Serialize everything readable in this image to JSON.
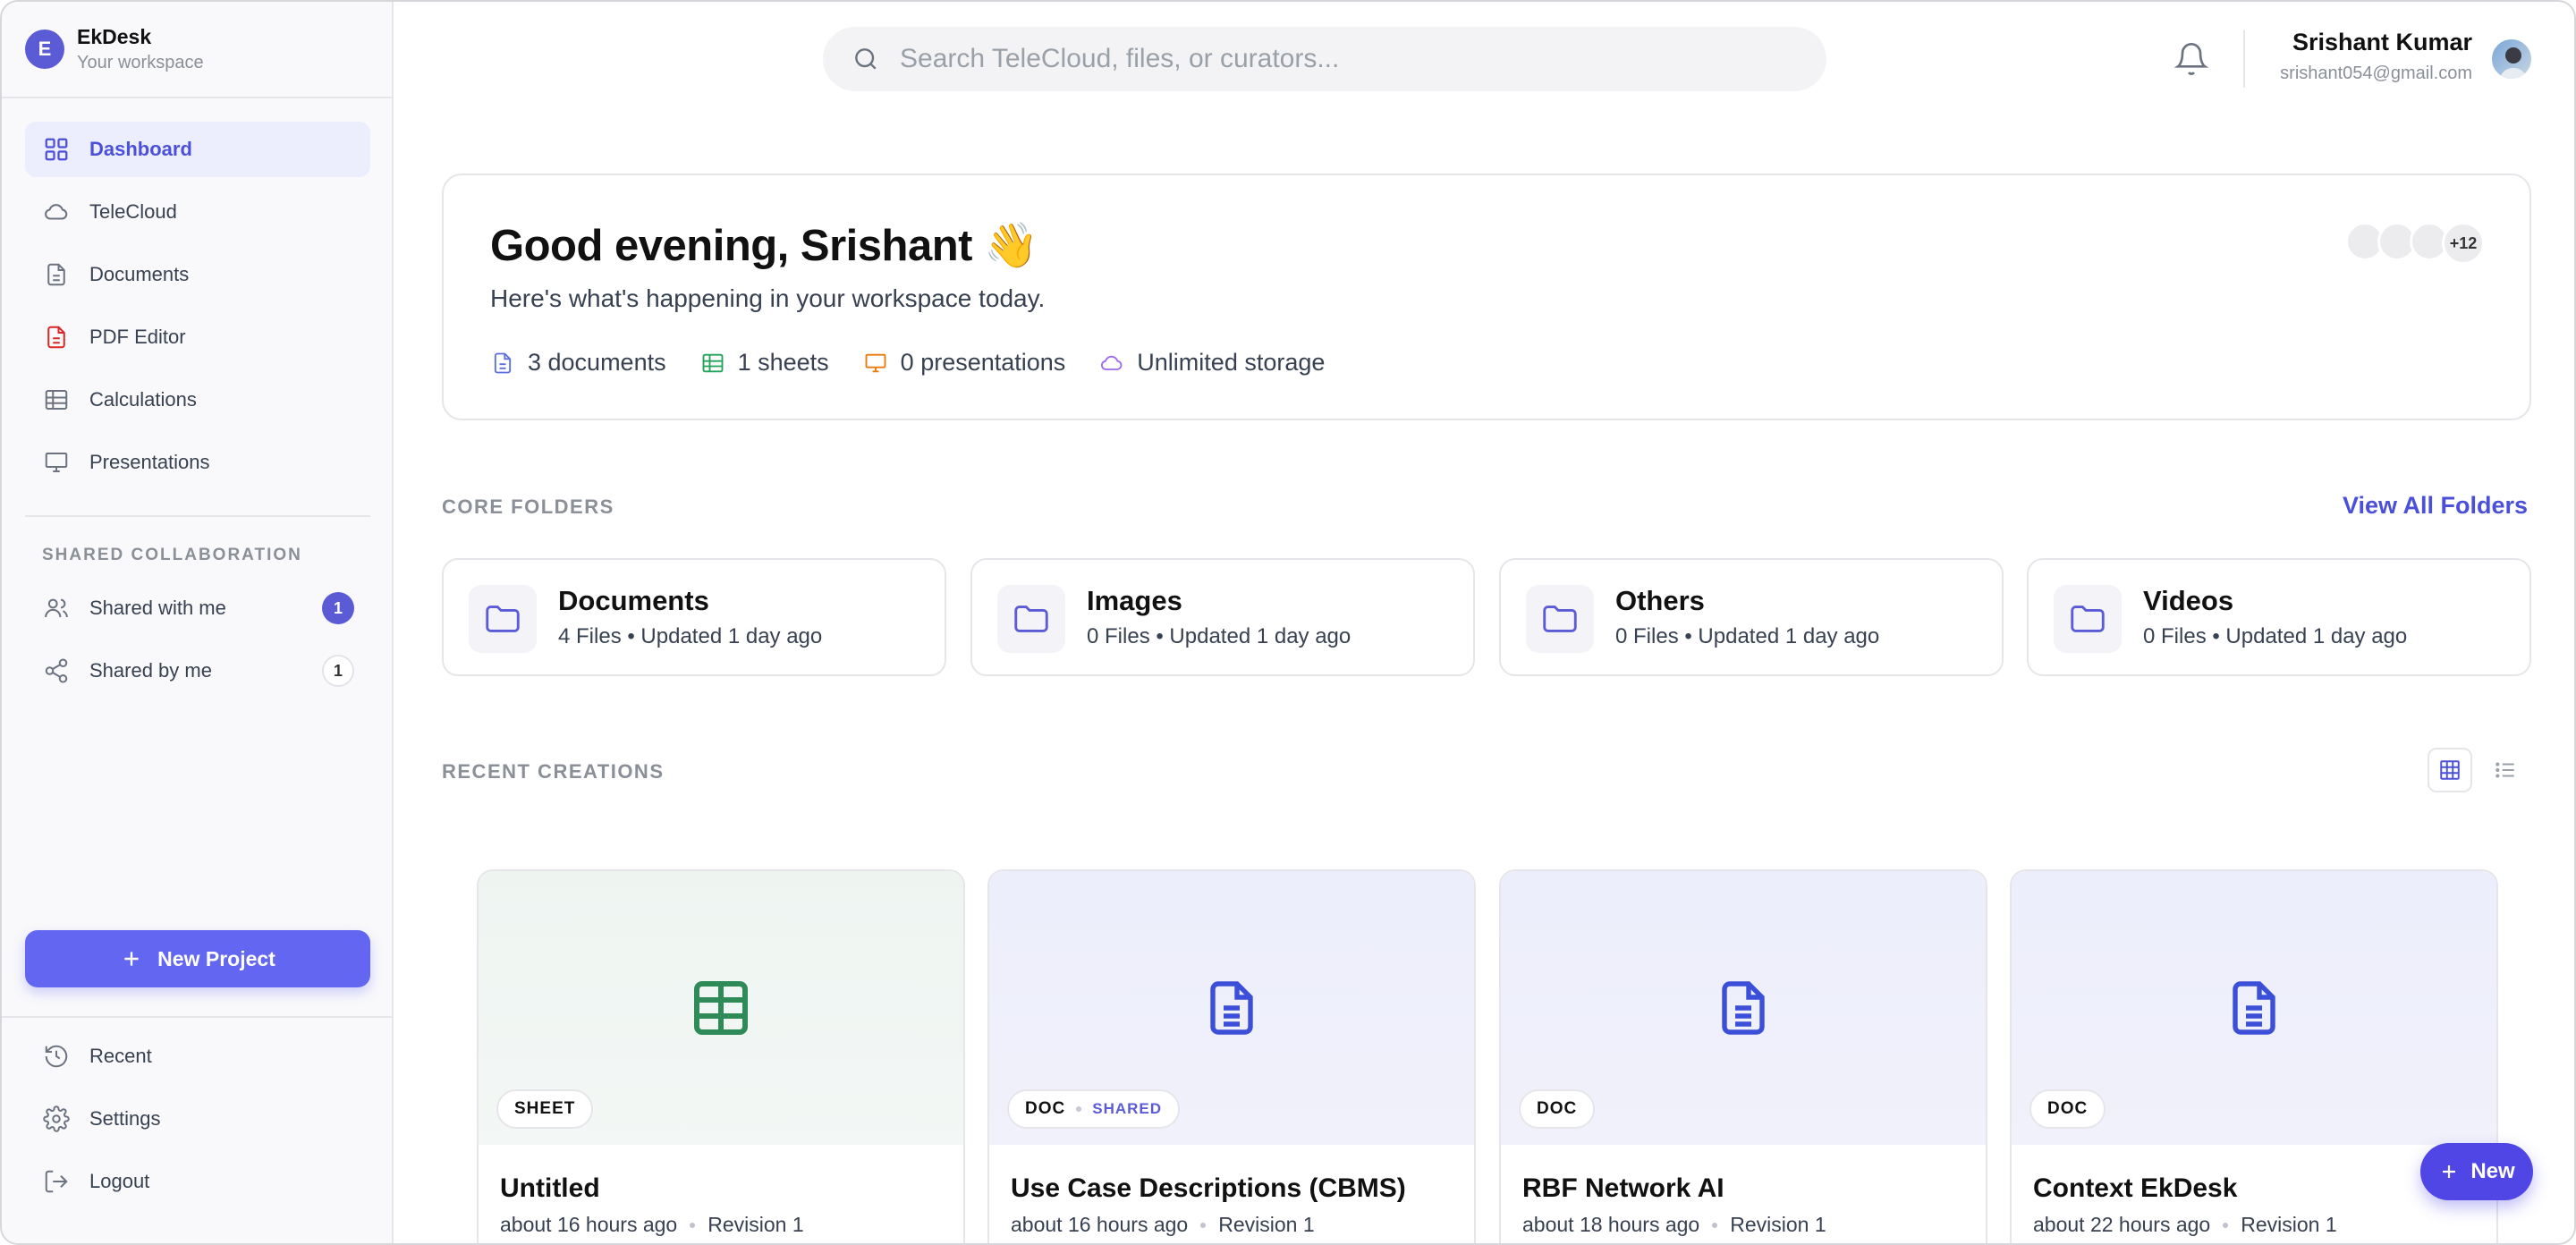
{
  "brand": {
    "logo_letter": "E",
    "name": "EkDesk",
    "subtitle": "Your workspace"
  },
  "sidebar": {
    "nav": [
      {
        "label": "Dashboard",
        "icon": "grid-icon",
        "active": true
      },
      {
        "label": "TeleCloud",
        "icon": "cloud-icon"
      },
      {
        "label": "Documents",
        "icon": "document-icon"
      },
      {
        "label": "PDF Editor",
        "icon": "pdf-icon"
      },
      {
        "label": "Calculations",
        "icon": "table-icon"
      },
      {
        "label": "Presentations",
        "icon": "presentation-icon"
      }
    ],
    "shared_section_label": "SHARED COLLABORATION",
    "shared": [
      {
        "label": "Shared with me",
        "count": "1",
        "icon": "users-icon"
      },
      {
        "label": "Shared by me",
        "count": "1",
        "icon": "share-icon"
      }
    ],
    "new_project_label": "New Project",
    "bottom": [
      {
        "label": "Recent",
        "icon": "history-icon"
      },
      {
        "label": "Settings",
        "icon": "gear-icon"
      },
      {
        "label": "Logout",
        "icon": "logout-icon"
      }
    ]
  },
  "search": {
    "placeholder": "Search TeleCloud, files, or curators..."
  },
  "user": {
    "name": "Srishant Kumar",
    "email": "srishant054@gmail.com"
  },
  "hero": {
    "greeting": "Good evening, Srishant 👋",
    "subtitle": "Here's what's happening in your workspace today.",
    "stats": [
      {
        "text": "3 documents",
        "icon": "document-icon",
        "color": "#5b6ee1"
      },
      {
        "text": "1 sheets",
        "icon": "table-icon",
        "color": "#22a35a"
      },
      {
        "text": "0 presentations",
        "icon": "presentation-icon",
        "color": "#ea7a0c"
      },
      {
        "text": "Unlimited storage",
        "icon": "cloud-icon",
        "color": "#9b6cf0"
      }
    ],
    "collaborators_more": "+12"
  },
  "core_folders": {
    "label": "CORE FOLDERS",
    "view_all": "View All Folders",
    "items": [
      {
        "name": "Documents",
        "meta": "4 Files • Updated 1 day ago"
      },
      {
        "name": "Images",
        "meta": "0 Files • Updated 1 day ago"
      },
      {
        "name": "Others",
        "meta": "0 Files • Updated 1 day ago"
      },
      {
        "name": "Videos",
        "meta": "0 Files • Updated 1 day ago"
      }
    ]
  },
  "recent": {
    "label": "RECENT CREATIONS",
    "cards": [
      {
        "type": "SHEET",
        "shared": "",
        "title": "Untitled",
        "time": "about 16 hours ago",
        "revision": "Revision 1"
      },
      {
        "type": "DOC",
        "shared": "SHARED",
        "title": "Use Case Descriptions (CBMS)",
        "time": "about 16 hours ago",
        "revision": "Revision 1"
      },
      {
        "type": "DOC",
        "shared": "",
        "title": "RBF Network AI",
        "time": "about 18 hours ago",
        "revision": "Revision 1"
      },
      {
        "type": "DOC",
        "shared": "",
        "title": "Context EkDesk",
        "time": "about 22 hours ago",
        "revision": "Revision 1"
      }
    ]
  },
  "fab": {
    "label": "New"
  },
  "colors": {
    "accent": "#6366f1",
    "accent_text": "#4b50d8",
    "sheet_green": "#2e8b57",
    "doc_blue": "#3b4fd8"
  }
}
